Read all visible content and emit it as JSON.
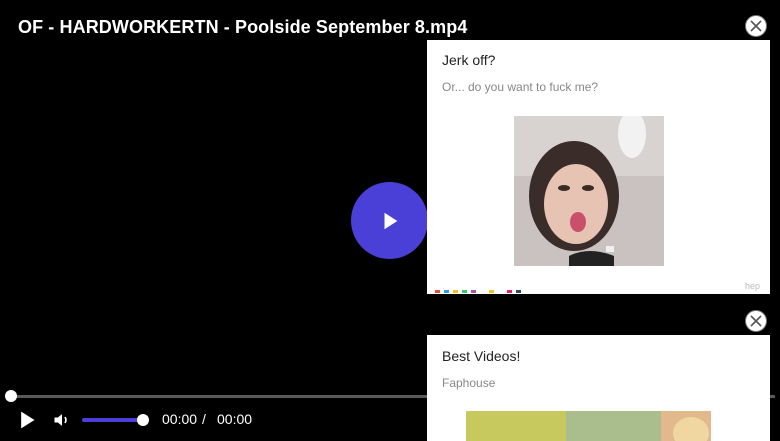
{
  "video": {
    "title": "OF - HARDWORKERTN - Poolside September 8.mp4",
    "current_time": "00:00",
    "separator": "/",
    "duration": "00:00",
    "progress": 0,
    "volume": 1.0
  },
  "ads": [
    {
      "title": "Jerk off?",
      "subtitle": "Or... do you want to fuck me?",
      "footer": "hep"
    },
    {
      "title": "Best Videos!",
      "subtitle": "Faphouse"
    }
  ],
  "icons": {
    "big_play": "play-icon",
    "play": "play-icon",
    "volume": "volume-icon",
    "close": "close-icon"
  },
  "colors": {
    "accent": "#4a3fd6",
    "background": "#000000",
    "dots": [
      "#e74c3c",
      "#3498db",
      "#f1c40f",
      "#2ecc71",
      "#9b59b6",
      "#f39c12",
      "#e91e63",
      "#34495e"
    ]
  }
}
